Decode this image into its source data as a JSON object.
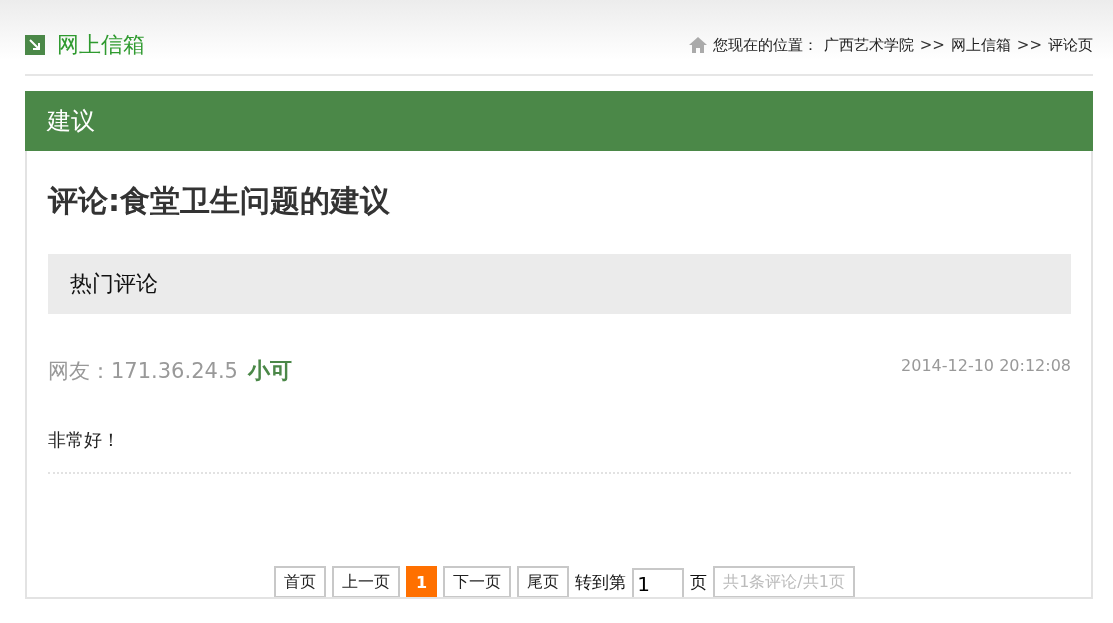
{
  "header": {
    "title": "网上信箱",
    "breadcrumb": [
      {
        "kind": "label",
        "text": "您现在的位置："
      },
      {
        "kind": "link",
        "text": "广西艺术学院"
      },
      {
        "kind": "separator",
        "text": ">>"
      },
      {
        "kind": "link",
        "text": "网上信箱"
      },
      {
        "kind": "separator",
        "text": ">>"
      },
      {
        "kind": "text",
        "text": "评论页"
      }
    ]
  },
  "category": "建议",
  "article_title": "评论:食堂卫生问题的建议",
  "section_heading": "热门评论",
  "comments": [
    {
      "author_label": "网友：171.36.24.5",
      "nickname": "小可",
      "time": "2014-12-10 20:12:08",
      "body": "非常好！"
    }
  ],
  "pagination": [
    {
      "kind": "button",
      "text": "首页"
    },
    {
      "kind": "button",
      "text": "上一页"
    },
    {
      "kind": "current",
      "text": "1"
    },
    {
      "kind": "button",
      "text": "下一页"
    },
    {
      "kind": "button",
      "text": "尾页"
    },
    {
      "kind": "label",
      "text": "转到第"
    },
    {
      "kind": "input",
      "value": "1"
    },
    {
      "kind": "label",
      "text": "页"
    },
    {
      "kind": "info",
      "text": "共1条评论/共1页"
    }
  ]
}
